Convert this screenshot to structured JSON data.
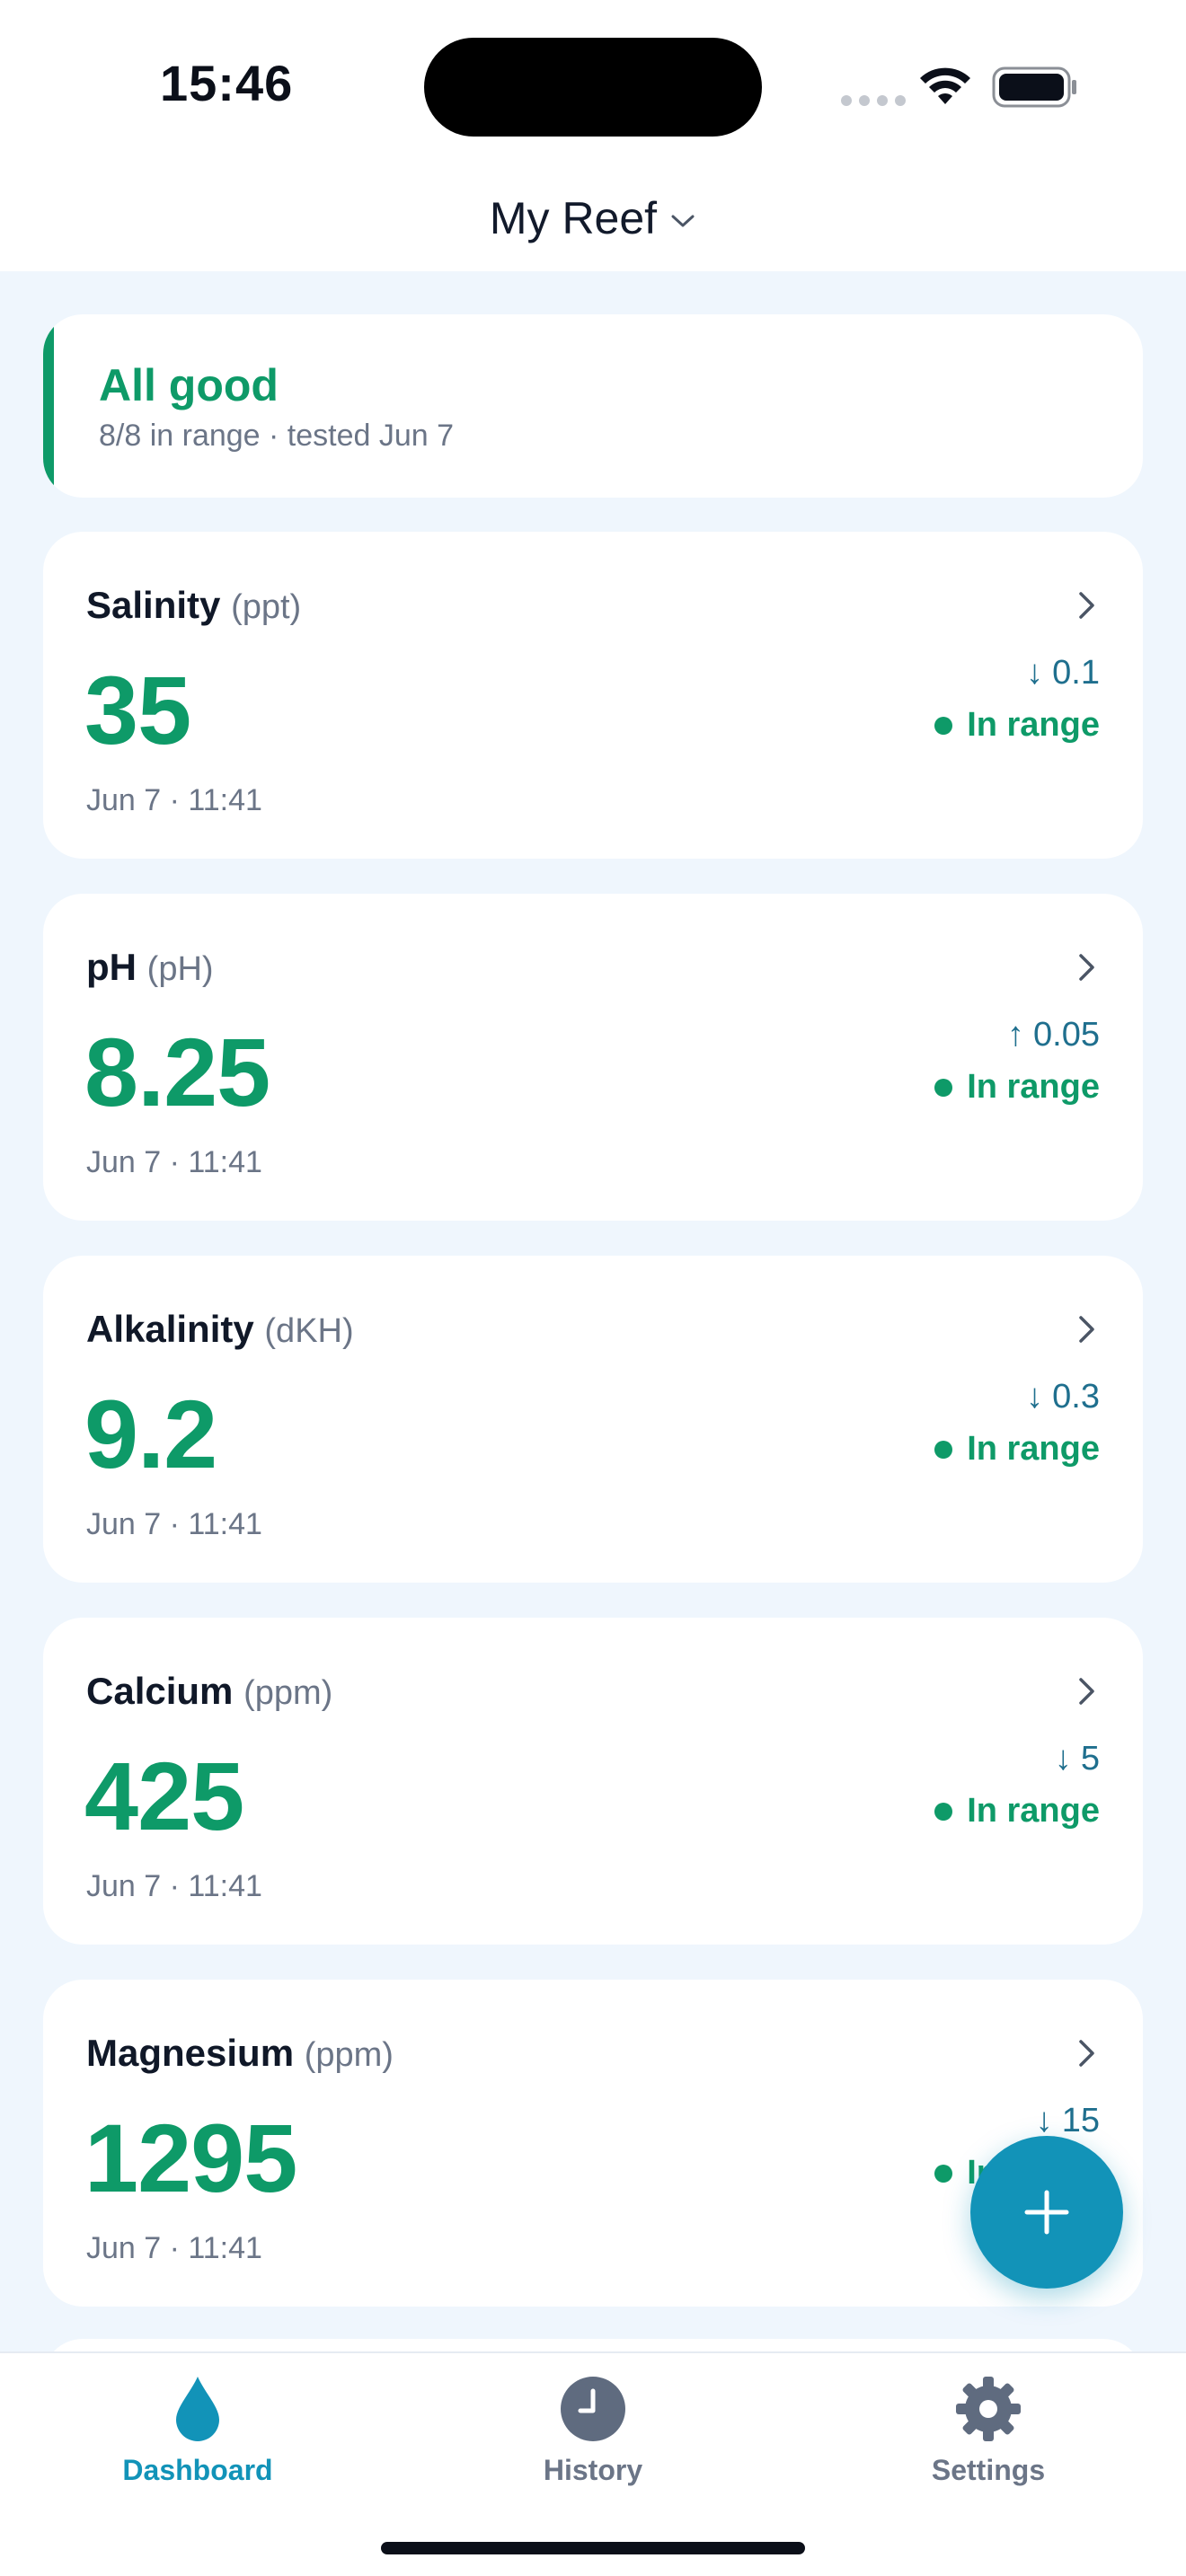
{
  "status_bar": {
    "time": "15:46"
  },
  "header": {
    "title": "My Reef"
  },
  "summary": {
    "title": "All good",
    "subtitle": "8/8 in range · tested Jun 7"
  },
  "metrics": [
    {
      "name": "Salinity",
      "unit": "(ppt)",
      "value": "35",
      "time": "Jun 7 · 11:41",
      "delta_arrow": "↓",
      "delta": "0.1",
      "status": "In range"
    },
    {
      "name": "pH",
      "unit": "(pH)",
      "value": "8.25",
      "time": "Jun 7 · 11:41",
      "delta_arrow": "↑",
      "delta": "0.05",
      "status": "In range"
    },
    {
      "name": "Alkalinity",
      "unit": "(dKH)",
      "value": "9.2",
      "time": "Jun 7 · 11:41",
      "delta_arrow": "↓",
      "delta": "0.3",
      "status": "In range"
    },
    {
      "name": "Calcium",
      "unit": "(ppm)",
      "value": "425",
      "time": "Jun 7 · 11:41",
      "delta_arrow": "↓",
      "delta": "5",
      "status": "In range"
    },
    {
      "name": "Magnesium",
      "unit": "(ppm)",
      "value": "1295",
      "time": "Jun 7 · 11:41",
      "delta_arrow": "↓",
      "delta": "15",
      "status": "In range"
    }
  ],
  "fab": {
    "icon": "plus-icon"
  },
  "tabs": [
    {
      "label": "Dashboard",
      "icon": "droplet-icon",
      "active": true
    },
    {
      "label": "History",
      "icon": "clock-icon",
      "active": false
    },
    {
      "label": "Settings",
      "icon": "gear-icon",
      "active": false
    }
  ],
  "colors": {
    "accent": "#1293b8",
    "good": "#0e9a68",
    "background": "#eff6fd",
    "muted": "#6b7587"
  }
}
